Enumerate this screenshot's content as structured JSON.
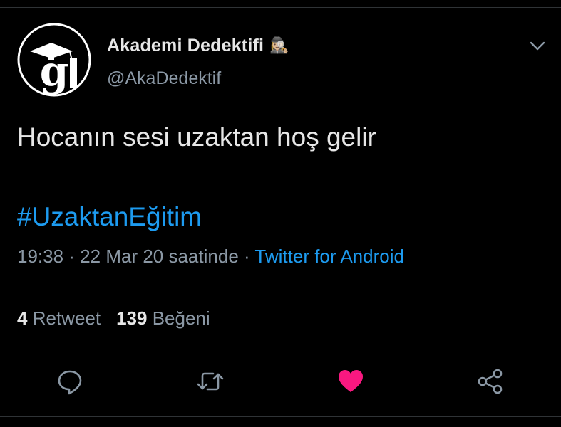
{
  "author": {
    "display_name": "Akademi Dedektifi",
    "emoji": "🕵🏼‍♀️",
    "handle": "@AkaDedektif",
    "avatar_icon": "graduation-cap-g-logo"
  },
  "tweet": {
    "text": "Hocanın sesi uzaktan hoş gelir",
    "hashtag": "#UzaktanEğitim"
  },
  "meta": {
    "time": "19:38",
    "sep1": " · ",
    "date": "22 Mar 20 saatinde",
    "sep2": " · ",
    "source": "Twitter for Android"
  },
  "stats": {
    "retweets_count": "4",
    "retweets_label": "Retweet",
    "likes_count": "139",
    "likes_label": "Beğeni"
  },
  "actions": [
    {
      "icon": "reply-icon"
    },
    {
      "icon": "retweet-icon"
    },
    {
      "icon": "like-icon",
      "active": true
    },
    {
      "icon": "share-icon"
    }
  ],
  "colors": {
    "background": "#000000",
    "accent": "#1d9bf0",
    "like": "#f91880",
    "secondary_text": "#8b98a5"
  }
}
